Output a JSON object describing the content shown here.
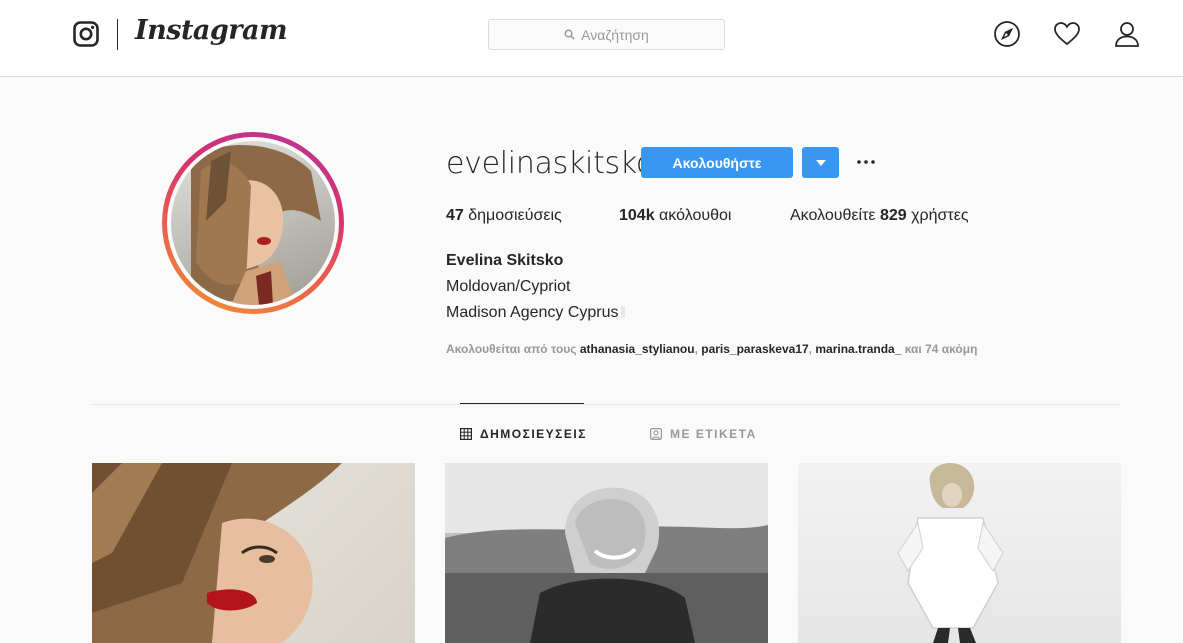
{
  "header": {
    "brand": "Instagram",
    "search_placeholder": "Αναζήτηση"
  },
  "profile": {
    "username": "evelinaskitsko",
    "follow_label": "Ακολουθήστε",
    "posts_count": "47",
    "posts_label": " δημοσιεύσεις",
    "followers_count": "104k",
    "followers_label": " ακόλουθοι",
    "following_prefix": "Ακολουθείτε ",
    "following_count": "829",
    "following_suffix": " χρήστες",
    "full_name": "Evelina Skitsko",
    "bio_line1": "Moldovan/Cypriot",
    "bio_line2": "Madison Agency Cyprus",
    "followed_by_prefix": "Ακολουθείται από τους ",
    "followed_by_users": [
      "athanasia_stylianou",
      "paris_paraskeva17",
      "marina.tranda_"
    ],
    "followed_by_suffix": " και 74 ακόμη"
  },
  "tabs": [
    {
      "label": "ΔΗΜΟΣΙΕΥΣΕΙΣ",
      "active": true
    },
    {
      "label": "ΜΕ ΕΤΙΚΕΤΑ",
      "active": false
    }
  ],
  "colors": {
    "accent": "#3897f0",
    "ring_gradient": [
      "#b7349b",
      "#d6336c",
      "#e95950",
      "#f09433"
    ]
  },
  "icons": [
    "instagram-glyph-icon",
    "search-icon",
    "compass-icon",
    "heart-icon",
    "profile-icon",
    "chevron-down-icon",
    "more-icon",
    "grid-icon",
    "tagged-icon"
  ]
}
